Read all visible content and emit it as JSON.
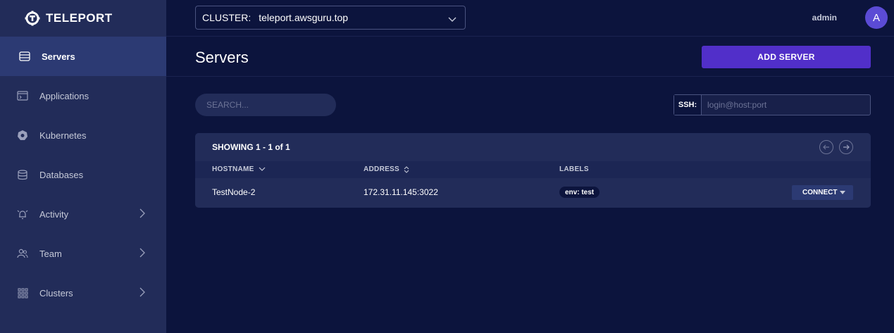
{
  "brand": {
    "name": "TELEPORT"
  },
  "sidebar": {
    "items": [
      {
        "label": "Servers",
        "icon": "server-icon",
        "active": true
      },
      {
        "label": "Applications",
        "icon": "app-window-icon"
      },
      {
        "label": "Kubernetes",
        "icon": "kubernetes-icon"
      },
      {
        "label": "Databases",
        "icon": "database-icon"
      },
      {
        "label": "Activity",
        "icon": "bell-icon",
        "expandable": true
      },
      {
        "label": "Team",
        "icon": "users-icon",
        "expandable": true
      },
      {
        "label": "Clusters",
        "icon": "grid-icon",
        "expandable": true
      }
    ]
  },
  "topbar": {
    "cluster_label": "CLUSTER:",
    "cluster_value": "teleport.awsguru.top",
    "username": "admin",
    "avatar_initial": "A"
  },
  "page": {
    "title": "Servers",
    "add_button": "ADD SERVER",
    "search_placeholder": "SEARCH...",
    "ssh_label": "SSH:",
    "ssh_placeholder": "login@host:port"
  },
  "table": {
    "showing_prefix": "SHOWING ",
    "showing_range": "1 - 1 of 1",
    "columns": [
      "HOSTNAME",
      "ADDRESS",
      "LABELS"
    ],
    "rows": [
      {
        "hostname": "TestNode-2",
        "address": "172.31.11.145:3022",
        "labels": [
          "env: test"
        ],
        "action": "CONNECT"
      }
    ]
  },
  "colors": {
    "accent": "#512fc9",
    "sidebar_bg": "#222c59",
    "page_bg": "#0c143d"
  }
}
